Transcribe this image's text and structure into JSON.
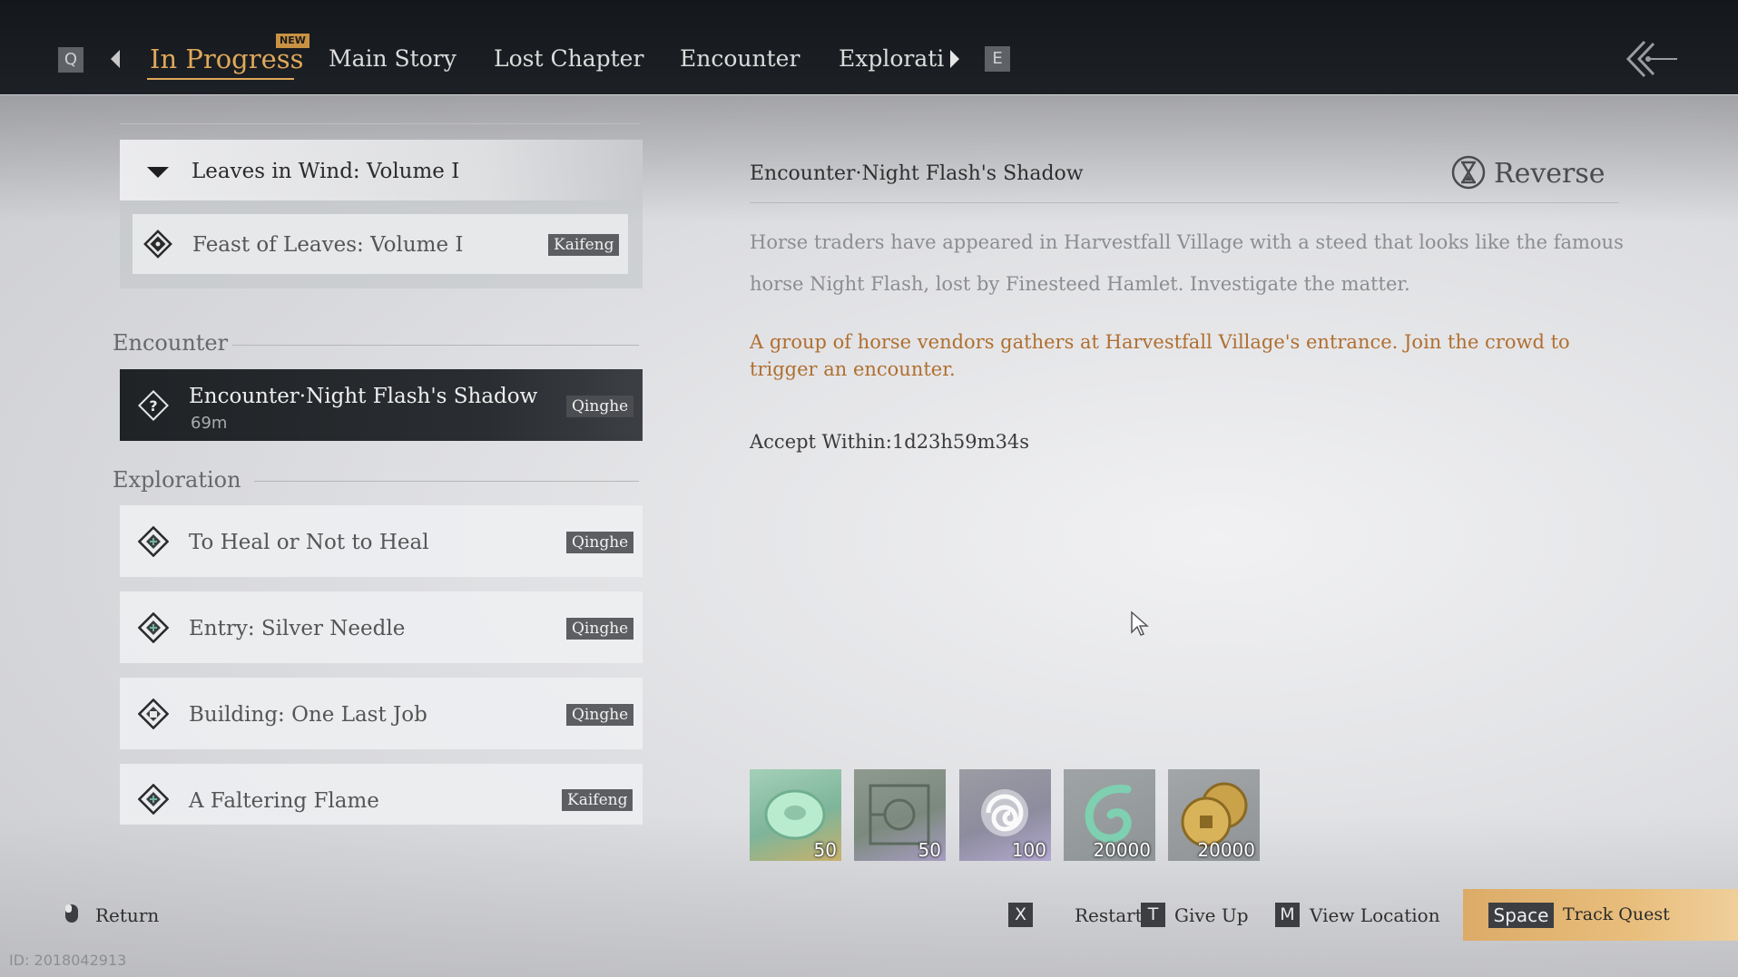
{
  "header": {
    "key_prev": "Q",
    "key_next": "E",
    "new_badge": "NEW",
    "tabs": [
      {
        "label": "In Progress"
      },
      {
        "label": "Main Story"
      },
      {
        "label": "Lost Chapter"
      },
      {
        "label": "Encounter"
      },
      {
        "label": "Explorati"
      }
    ],
    "active_tab": "In Progress"
  },
  "quest_list": {
    "volume": {
      "title": "Leaves in Wind: Volume I",
      "items": [
        {
          "name": "Feast of Leaves: Volume I",
          "region": "Kaifeng"
        }
      ]
    },
    "encounter_section": {
      "label": "Encounter",
      "items": [
        {
          "name": "Encounter·Night Flash's Shadow",
          "distance": "69m",
          "region": "Qinghe",
          "selected": true
        }
      ]
    },
    "exploration_section": {
      "label": "Exploration",
      "items": [
        {
          "name": "To Heal or Not to Heal",
          "region": "Qinghe"
        },
        {
          "name": "Entry: Silver Needle",
          "region": "Qinghe"
        },
        {
          "name": "Building: One Last Job",
          "region": "Qinghe"
        },
        {
          "name": "A Faltering Flame",
          "region": "Kaifeng"
        }
      ]
    }
  },
  "detail": {
    "title": "Encounter·Night Flash's Shadow",
    "reverse_label": "Reverse",
    "description": "Horse traders have appeared in Harvestfall Village with a steed that looks like the famous horse Night Flash, lost by Finesteed Hamlet. Investigate the matter.",
    "hint": "A group of horse vendors gathers at Harvestfall Village's entrance. Join the crowd to trigger an encounter.",
    "accept_within": "Accept Within:1d23h59m34s",
    "rewards": [
      {
        "icon": "jade-ring-icon",
        "qty": "50"
      },
      {
        "icon": "manual-scroll-icon",
        "qty": "50"
      },
      {
        "icon": "spiral-essence-icon",
        "qty": "100"
      },
      {
        "icon": "wind-swirl-icon",
        "qty": "20000"
      },
      {
        "icon": "coins-icon",
        "qty": "20000"
      }
    ]
  },
  "footer": {
    "return_label": "Return",
    "restart_key": "X",
    "restart_label": "Restart",
    "giveup_key": "T",
    "giveup_label": "Give Up",
    "location_key": "M",
    "location_label": "View Location",
    "track_key": "Space",
    "track_label": "Track Quest",
    "id_label": "ID: 2018042913"
  },
  "colors": {
    "accent": "#e0a85a",
    "hint_text": "#b06f30",
    "track_button": "#e1b26f",
    "tag_bg": "#5c5e61"
  }
}
